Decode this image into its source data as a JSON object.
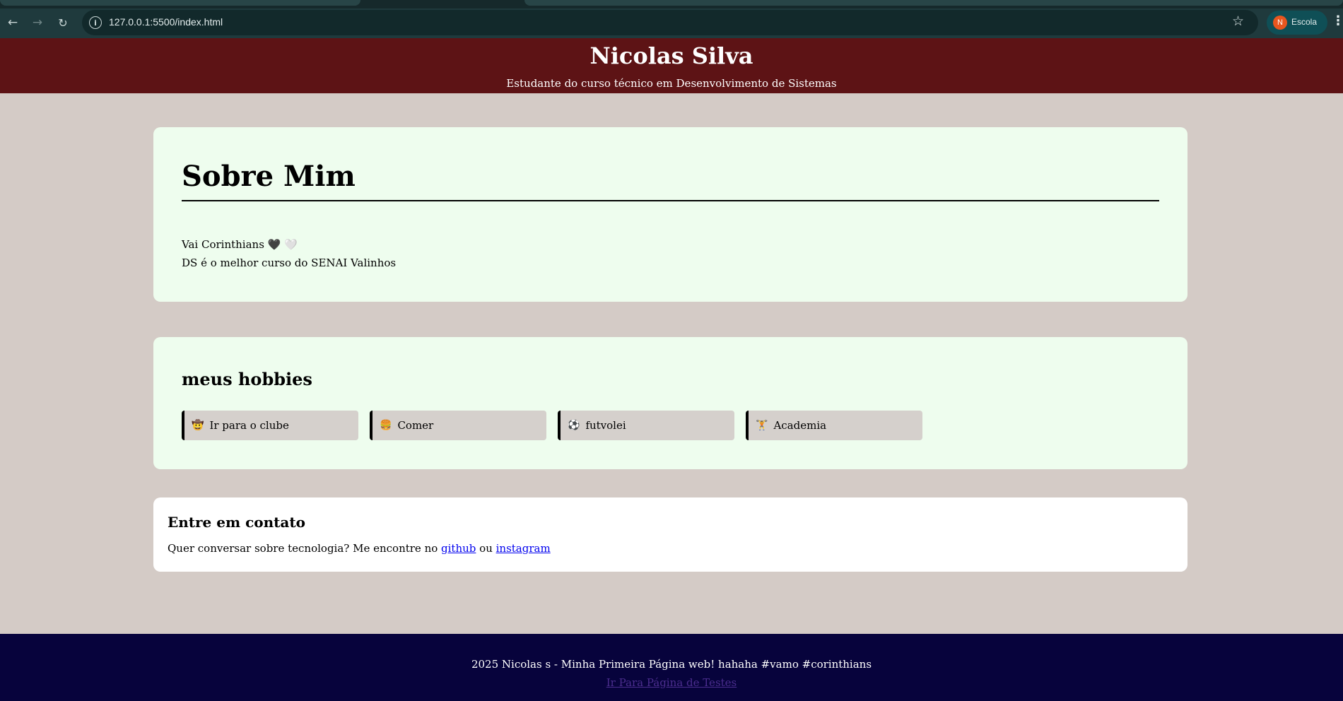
{
  "browser": {
    "url": "127.0.0.1:5500/index.html",
    "profile_initial": "N",
    "profile_name": "Escola",
    "icons": {
      "back": "arrow-left-icon",
      "forward": "arrow-right-icon",
      "reload": "reload-icon",
      "site_info": "info-icon",
      "bookmark": "star-icon",
      "menu": "kebab-menu-icon"
    }
  },
  "header": {
    "title": "Nicolas Silva",
    "subtitle": "Estudante do curso técnico em Desenvolvimento de Sistemas"
  },
  "sobre": {
    "title": "Sobre Mim",
    "line1": "Vai Corinthians 🖤 🤍",
    "line2": "DS é o melhor curso do SENAI Valinhos"
  },
  "hobbies": {
    "title": "meus hobbies",
    "items": [
      {
        "emoji": "🤠",
        "label": "Ir para o clube"
      },
      {
        "emoji": "🍔",
        "label": "Comer"
      },
      {
        "emoji": "⚽",
        "label": "futvolei"
      },
      {
        "emoji": "🏋",
        "label": "Academia"
      }
    ]
  },
  "contato": {
    "title": "Entre em contato",
    "text_before": "Quer conversar sobre tecnologia? Me encontre no ",
    "link1": "github",
    "text_middle": " ou ",
    "link2": "instagram"
  },
  "footer": {
    "copyright": "2025 Nicolas s - Minha Primeira Página web! hahaha #vamo #corinthians",
    "test_link": "Ir Para Página de Testes"
  },
  "colors": {
    "header_bg": "#5d1315",
    "page_bg": "#d4cbc6",
    "card_bg": "#eefdee",
    "footer_bg": "#07033c",
    "browser_chrome": "#1f3a3d"
  }
}
